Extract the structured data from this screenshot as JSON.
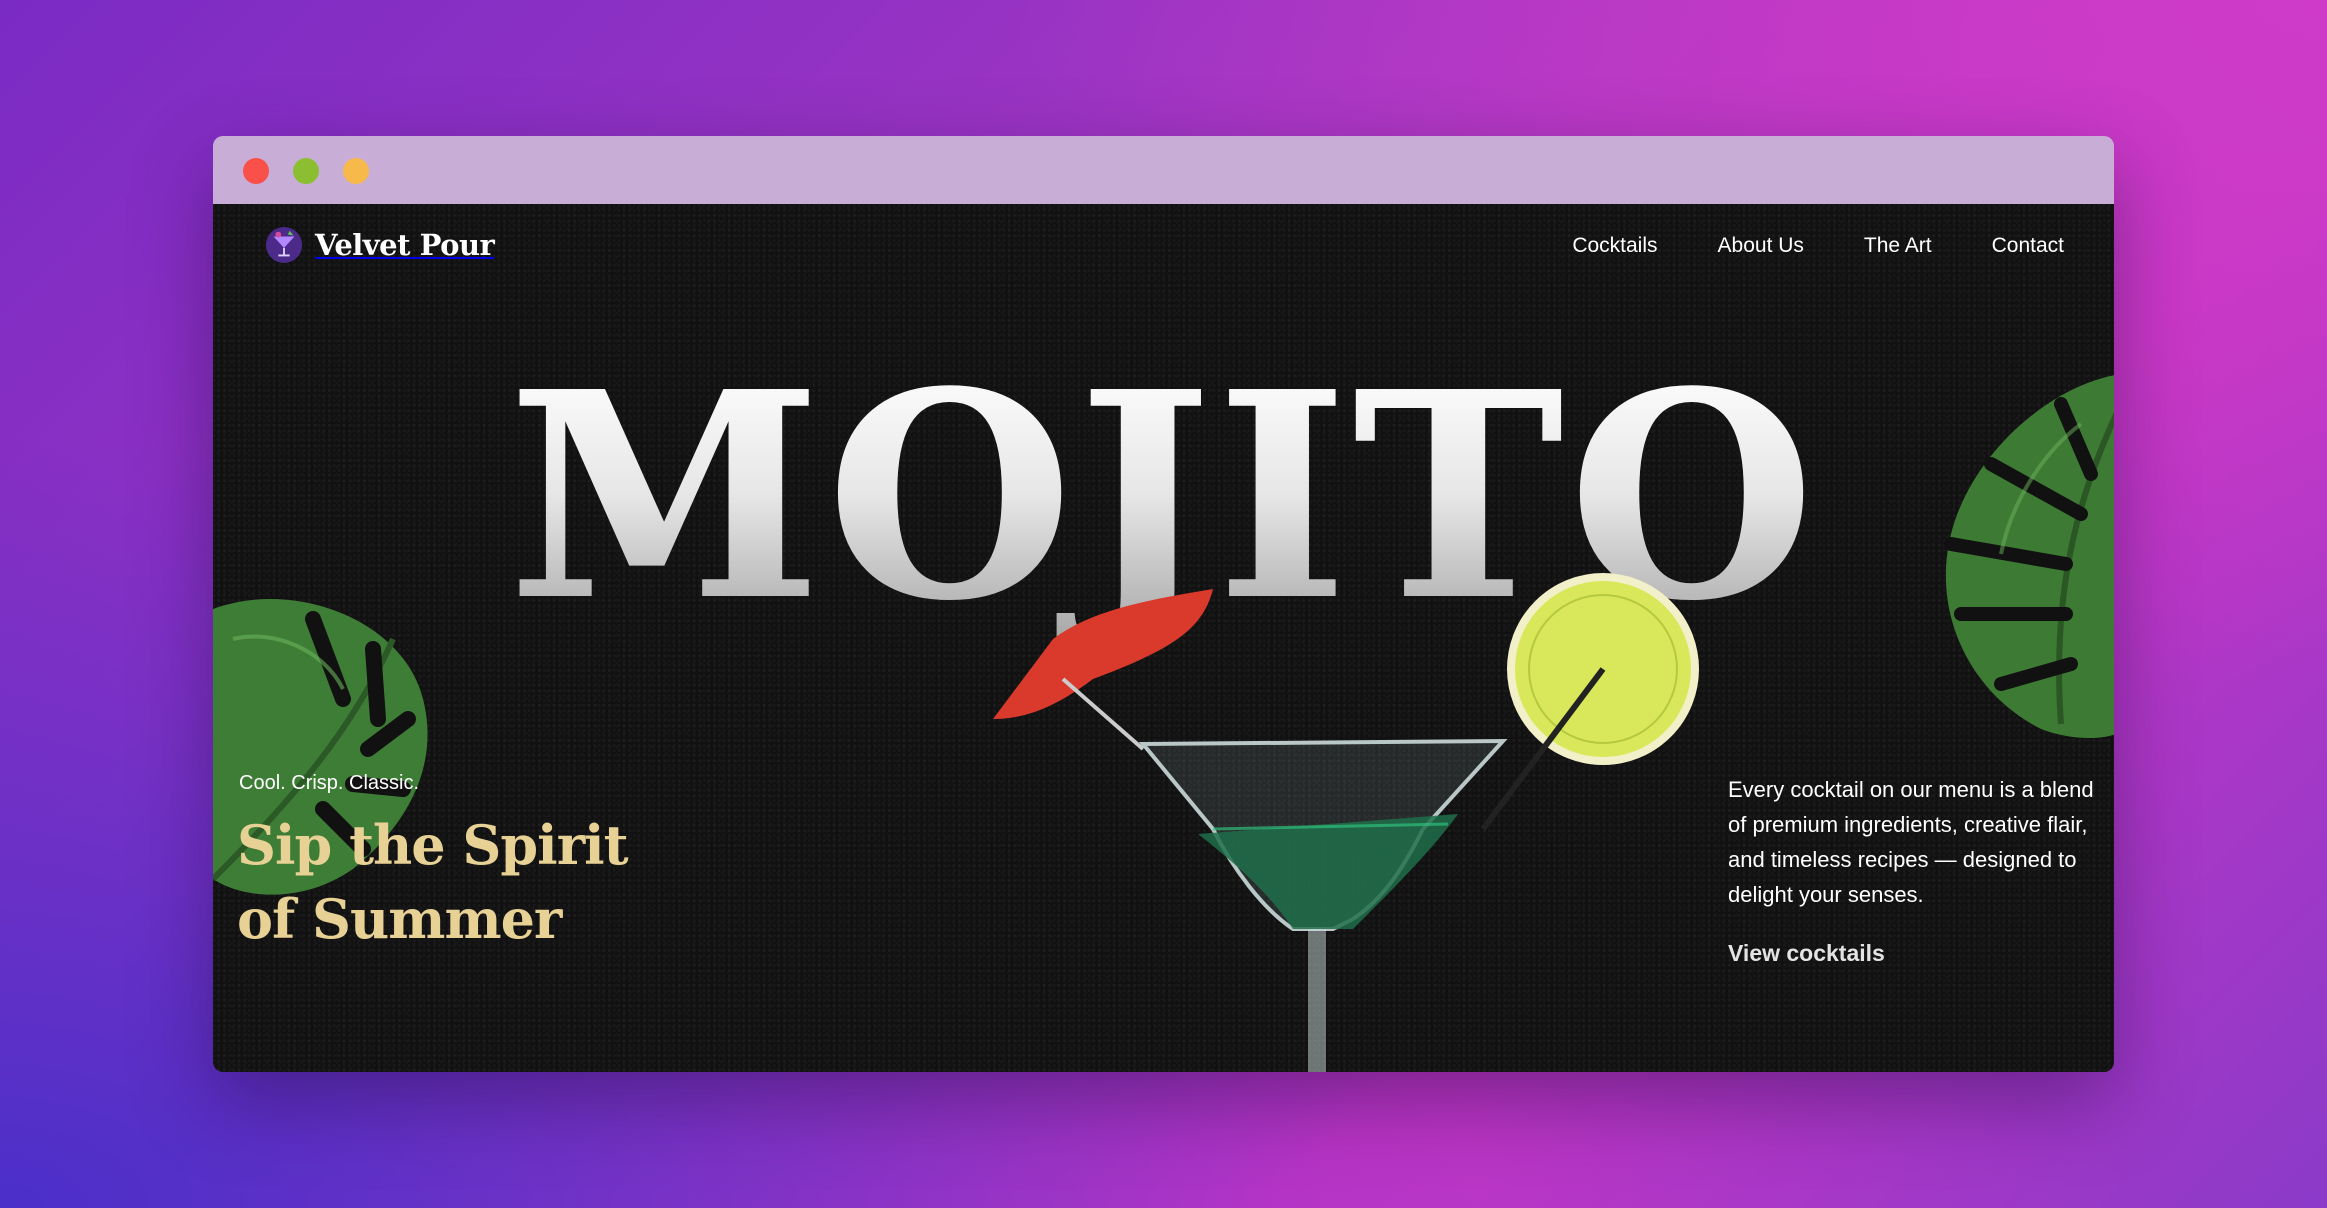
{
  "brand": {
    "name": "Velvet Pour"
  },
  "nav": {
    "items": [
      {
        "label": "Cocktails"
      },
      {
        "label": "About Us"
      },
      {
        "label": "The Art"
      },
      {
        "label": "Contact"
      }
    ]
  },
  "hero": {
    "title": "MOJITO",
    "tagline": "Cool. Crisp. Classic.",
    "headline": "Sip the Spirit of Summer",
    "description": "Every cocktail on our menu is a blend of premium ingredients, creative flair, and timeless recipes — designed to delight your senses.",
    "cta_label": "View cocktails"
  },
  "colors": {
    "background_gradient": [
      "#7a2bc4",
      "#c435c5"
    ],
    "titlebar": "#c8aed6",
    "page_bg": "#111111",
    "headline": "#e8d195",
    "traffic_lights": [
      "#f9504a",
      "#8bbe30",
      "#f6b94a"
    ]
  },
  "icons": {
    "logo": "cocktail-glass-icon",
    "window_controls": [
      "close-dot",
      "minimize-dot",
      "maximize-dot"
    ]
  }
}
